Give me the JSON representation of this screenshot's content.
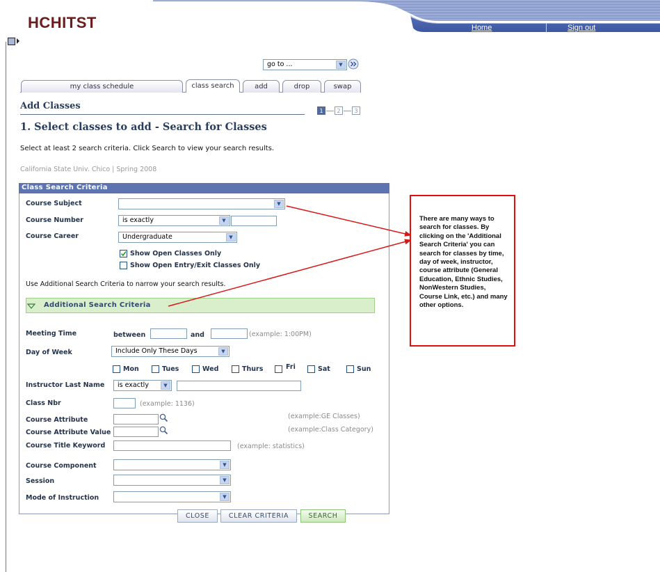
{
  "header": {
    "brand": "HCHITST",
    "home_link": "Home",
    "signout_link": "Sign out"
  },
  "goto": {
    "value": "go to ..."
  },
  "tabs": [
    "my class schedule",
    "class search",
    "add",
    "drop",
    "swap"
  ],
  "page": {
    "section_title": "Add Classes",
    "steps": [
      "1",
      "2",
      "3"
    ],
    "step_title": "1.  Select classes to add - Search for Classes",
    "instructions": "Select at least 2 search criteria. Click Search to view your search results.",
    "institution_term": "California State Univ. Chico | Spring 2008"
  },
  "criteria": {
    "header": "Class Search Criteria",
    "course_subject_label": "Course Subject",
    "course_subject_value": "",
    "course_number_label": "Course Number",
    "course_number_op": "is exactly",
    "course_career_label": "Course Career",
    "course_career_value": "Undergraduate",
    "show_open_label": "Show Open Classes Only",
    "show_open_checked": true,
    "show_open_entry_label": "Show Open Entry/Exit Classes Only",
    "show_open_entry_checked": false,
    "additional_hint": "Use Additional Search Criteria to narrow your search results.",
    "additional_header": "Additional Search Criteria"
  },
  "additional": {
    "meeting_time_label": "Meeting Time",
    "between_label": "between",
    "and_label": "and",
    "time_example": "(example: 1:00PM)",
    "day_of_week_label": "Day of Week",
    "day_of_week_value": "Include Only These Days",
    "days": [
      "Mon",
      "Tues",
      "Wed",
      "Thurs",
      "Fri",
      "Sat",
      "Sun"
    ],
    "instructor_label": "Instructor Last Name",
    "instructor_op": "is exactly",
    "class_nbr_label": "Class Nbr",
    "class_nbr_example": "(example: 1136)",
    "course_attribute_label": "Course Attribute",
    "course_attribute_example": "(example:GE Classes)",
    "course_attribute_value_label": "Course Attribute Value",
    "course_attribute_value_example": "(example:Class Category)",
    "course_title_keyword_label": "Course Title Keyword",
    "course_title_keyword_example": "(example: statistics)",
    "course_component_label": "Course Component",
    "session_label": "Session",
    "mode_label": "Mode of Instruction"
  },
  "buttons": {
    "close": "CLOSE",
    "clear": "CLEAR CRITERIA",
    "search": "SEARCH"
  },
  "callout": {
    "lines": [
      "There are many ways to",
      "search for classes. By",
      "clicking on the 'Additional",
      "Search Criteria' you can",
      "search for classes by time,",
      "day of week, instructor,",
      "course attribute (General",
      "Education, Ethnic Studies,",
      "NonWestern Studies,",
      "Course Link, etc.) and many",
      "other options."
    ]
  },
  "colors": {
    "brand": "#6b1d1d",
    "banner": "#4a64ad",
    "criteria_header": "#5d74b0",
    "additional_header_bg": "#d9efcc",
    "callout_border": "#e01010",
    "arrow": "#d81818"
  }
}
